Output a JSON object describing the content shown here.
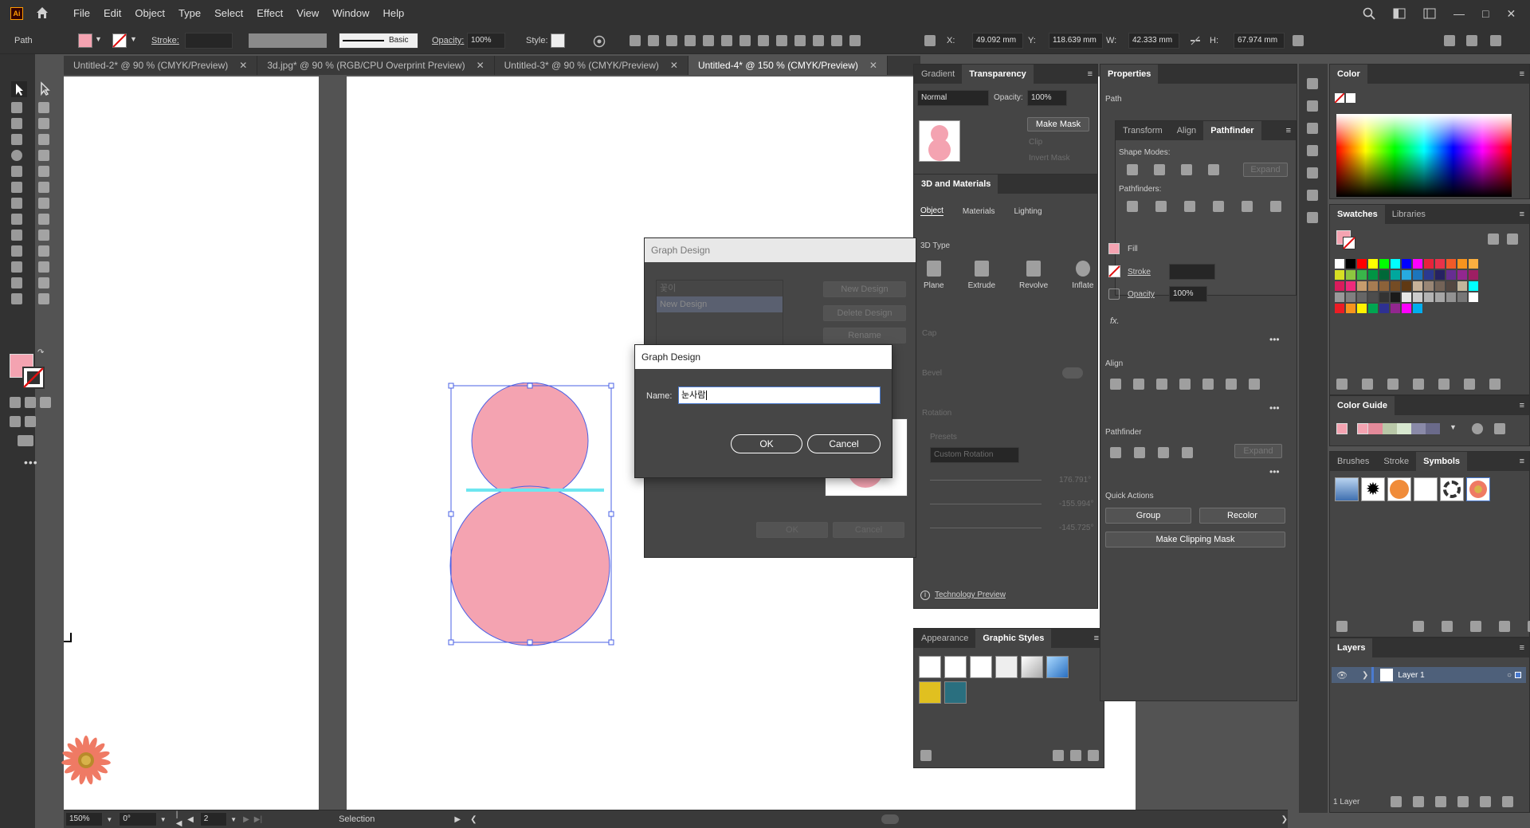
{
  "app": {
    "logo": "Ai"
  },
  "menu": [
    "File",
    "Edit",
    "Object",
    "Type",
    "Select",
    "Effect",
    "View",
    "Window",
    "Help"
  ],
  "control": {
    "path": "Path",
    "stroke_label": "Stroke:",
    "brush": "Basic",
    "opacity_label": "Opacity:",
    "opacity": "100%",
    "style_label": "Style:",
    "x_label": "X:",
    "x": "49.092 mm",
    "y_label": "Y:",
    "y": "118.639 mm",
    "w_label": "W:",
    "w": "42.333 mm",
    "h_label": "H:",
    "h": "67.974 mm"
  },
  "tabs": [
    {
      "label": "Untitled-2* @ 90 % (CMYK/Preview)"
    },
    {
      "label": "3d.jpg* @ 90 % (RGB/CPU Overprint Preview)"
    },
    {
      "label": "Untitled-3* @ 90 % (CMYK/Preview)"
    },
    {
      "label": "Untitled-4* @ 150 % (CMYK/Preview)"
    }
  ],
  "colors": {
    "pink": "#f4a3b1",
    "selection": "#4a60e6",
    "guide": "#6de6f0",
    "accent": "#4a7bd0"
  },
  "gradient_panel": {
    "tab1": "Gradient",
    "tab2": "Transparency",
    "mode": "Normal",
    "opacity_label": "Opacity:",
    "opacity": "100%",
    "make_mask": "Make Mask",
    "clip": "Clip",
    "invert_mask": "Invert Mask"
  },
  "materials_panel": {
    "title": "3D and Materials",
    "tabs": [
      "Object",
      "Materials",
      "Lighting"
    ],
    "type_label": "3D Type",
    "types": [
      "Plane",
      "Extrude",
      "Revolve",
      "Inflate"
    ],
    "cap": "Cap",
    "bevel": "Bevel",
    "rotation": "Rotation",
    "presets": "Presets",
    "preset_value": "Custom Rotation",
    "angles": [
      "176.791°",
      "-155.994°",
      "-145.725°"
    ],
    "tech_preview": "Technology Preview"
  },
  "properties": {
    "title": "Properties",
    "object": "Path",
    "sub_tabs": [
      "Transform",
      "Align",
      "Pathfinder"
    ],
    "shape_modes": "Shape Modes:",
    "pathfinders": "Pathfinders:",
    "expand": "Expand",
    "fill": "Fill",
    "stroke": "Stroke",
    "opacity": "Opacity",
    "opacity_value": "100%",
    "fx": "fx.",
    "align": "Align",
    "pathfinder": "Pathfinder",
    "quick_actions": "Quick Actions",
    "group": "Group",
    "recolor": "Recolor",
    "make_clipping_mask": "Make Clipping Mask"
  },
  "appearance": {
    "tab1": "Appearance",
    "tab2": "Graphic Styles"
  },
  "color_panel": {
    "title": "Color"
  },
  "swatches": {
    "tab1": "Swatches",
    "tab2": "Libraries"
  },
  "color_guide": {
    "title": "Color Guide"
  },
  "symbols": {
    "tabs": [
      "Brushes",
      "Stroke",
      "Symbols"
    ]
  },
  "layers": {
    "title": "Layers",
    "layer_name": "Layer 1",
    "footer": "1 Layer"
  },
  "graph_back": {
    "title": "Graph Design",
    "list_items": [
      "꽃이",
      "New Design"
    ],
    "buttons": [
      "New Design",
      "Delete Design",
      "Rename"
    ],
    "ok": "OK",
    "cancel": "Cancel"
  },
  "graph_front": {
    "title": "Graph Design",
    "name_label": "Name:",
    "name_value": "눈사람",
    "ok": "OK",
    "cancel": "Cancel"
  },
  "status": {
    "zoom": "150%",
    "rotate": "0°",
    "page": "2",
    "tool": "Selection"
  }
}
